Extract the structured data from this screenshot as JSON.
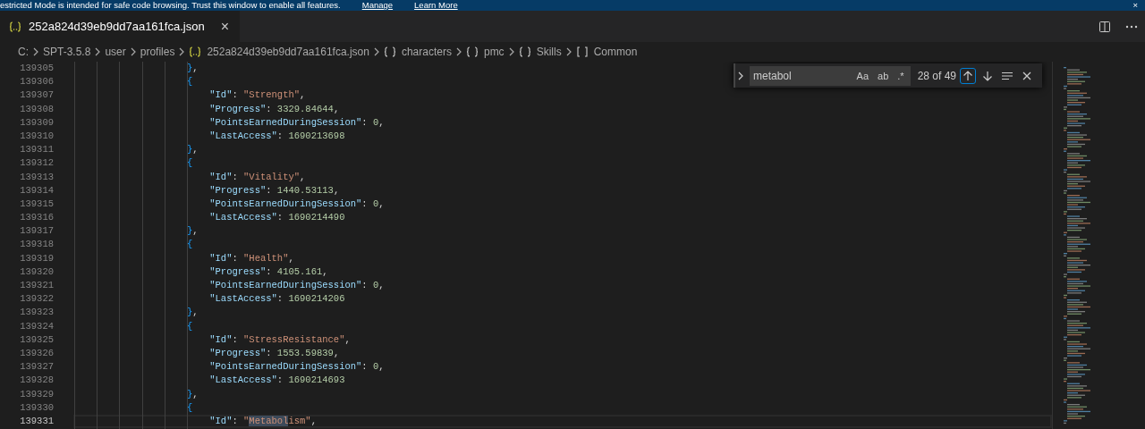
{
  "banner": {
    "text": "estricted Mode is intended for safe code browsing. Trust this window to enable all features.",
    "links": [
      "Manage",
      "Learn More"
    ],
    "close": "×"
  },
  "tabs": [
    {
      "label": "252a824d39eb9dd7aa161fca.json",
      "selected": true,
      "close": "×"
    }
  ],
  "breadcrumbs": [
    {
      "label": "C:",
      "kind": "folder"
    },
    {
      "label": "SPT-3.5.8",
      "kind": "folder"
    },
    {
      "label": "user",
      "kind": "folder"
    },
    {
      "label": "profiles",
      "kind": "folder"
    },
    {
      "label": "252a824d39eb9dd7aa161fca.json",
      "kind": "file"
    },
    {
      "label": "characters",
      "kind": "object"
    },
    {
      "label": "pmc",
      "kind": "object"
    },
    {
      "label": "Skills",
      "kind": "object"
    },
    {
      "label": "Common",
      "kind": "array"
    }
  ],
  "find": {
    "value": "metabol",
    "options": [
      {
        "label": "Aa",
        "on": false
      },
      {
        "label": "ab",
        "on": false
      },
      {
        "label": ".*",
        "on": false
      }
    ],
    "count": "28 of 49"
  },
  "lines": [
    {
      "number": "139305",
      "current": false,
      "tokens": [
        {
          "kind": "brace",
          "text": "                    }"
        },
        {
          "kind": "punct",
          "text": ","
        }
      ]
    },
    {
      "number": "139306",
      "current": false,
      "tokens": [
        {
          "kind": "brace",
          "text": "                    {"
        }
      ]
    },
    {
      "number": "139307",
      "current": false,
      "tokens": [
        {
          "kind": "key",
          "text": "                        \"Id\""
        },
        {
          "kind": "punct",
          "text": ": "
        },
        {
          "kind": "string",
          "text": "\"Strength\""
        },
        {
          "kind": "punct",
          "text": ","
        }
      ]
    },
    {
      "number": "139308",
      "current": false,
      "tokens": [
        {
          "kind": "key",
          "text": "                        \"Progress\""
        },
        {
          "kind": "punct",
          "text": ": "
        },
        {
          "kind": "number",
          "text": "3329.84644"
        },
        {
          "kind": "punct",
          "text": ","
        }
      ]
    },
    {
      "number": "139309",
      "current": false,
      "tokens": [
        {
          "kind": "key",
          "text": "                        \"PointsEarnedDuringSession\""
        },
        {
          "kind": "punct",
          "text": ": "
        },
        {
          "kind": "number",
          "text": "0"
        },
        {
          "kind": "punct",
          "text": ","
        }
      ]
    },
    {
      "number": "139310",
      "current": false,
      "tokens": [
        {
          "kind": "key",
          "text": "                        \"LastAccess\""
        },
        {
          "kind": "punct",
          "text": ": "
        },
        {
          "kind": "number",
          "text": "1690213698"
        }
      ]
    },
    {
      "number": "139311",
      "current": false,
      "tokens": [
        {
          "kind": "brace",
          "text": "                    }"
        },
        {
          "kind": "punct",
          "text": ","
        }
      ]
    },
    {
      "number": "139312",
      "current": false,
      "tokens": [
        {
          "kind": "brace",
          "text": "                    {"
        }
      ]
    },
    {
      "number": "139313",
      "current": false,
      "tokens": [
        {
          "kind": "key",
          "text": "                        \"Id\""
        },
        {
          "kind": "punct",
          "text": ": "
        },
        {
          "kind": "string",
          "text": "\"Vitality\""
        },
        {
          "kind": "punct",
          "text": ","
        }
      ]
    },
    {
      "number": "139314",
      "current": false,
      "tokens": [
        {
          "kind": "key",
          "text": "                        \"Progress\""
        },
        {
          "kind": "punct",
          "text": ": "
        },
        {
          "kind": "number",
          "text": "1440.53113"
        },
        {
          "kind": "punct",
          "text": ","
        }
      ]
    },
    {
      "number": "139315",
      "current": false,
      "tokens": [
        {
          "kind": "key",
          "text": "                        \"PointsEarnedDuringSession\""
        },
        {
          "kind": "punct",
          "text": ": "
        },
        {
          "kind": "number",
          "text": "0"
        },
        {
          "kind": "punct",
          "text": ","
        }
      ]
    },
    {
      "number": "139316",
      "current": false,
      "tokens": [
        {
          "kind": "key",
          "text": "                        \"LastAccess\""
        },
        {
          "kind": "punct",
          "text": ": "
        },
        {
          "kind": "number",
          "text": "1690214490"
        }
      ]
    },
    {
      "number": "139317",
      "current": false,
      "tokens": [
        {
          "kind": "brace",
          "text": "                    }"
        },
        {
          "kind": "punct",
          "text": ","
        }
      ]
    },
    {
      "number": "139318",
      "current": false,
      "tokens": [
        {
          "kind": "brace",
          "text": "                    {"
        }
      ]
    },
    {
      "number": "139319",
      "current": false,
      "tokens": [
        {
          "kind": "key",
          "text": "                        \"Id\""
        },
        {
          "kind": "punct",
          "text": ": "
        },
        {
          "kind": "string",
          "text": "\"Health\""
        },
        {
          "kind": "punct",
          "text": ","
        }
      ]
    },
    {
      "number": "139320",
      "current": false,
      "tokens": [
        {
          "kind": "key",
          "text": "                        \"Progress\""
        },
        {
          "kind": "punct",
          "text": ": "
        },
        {
          "kind": "number",
          "text": "4105.161"
        },
        {
          "kind": "punct",
          "text": ","
        }
      ]
    },
    {
      "number": "139321",
      "current": false,
      "tokens": [
        {
          "kind": "key",
          "text": "                        \"PointsEarnedDuringSession\""
        },
        {
          "kind": "punct",
          "text": ": "
        },
        {
          "kind": "number",
          "text": "0"
        },
        {
          "kind": "punct",
          "text": ","
        }
      ]
    },
    {
      "number": "139322",
      "current": false,
      "tokens": [
        {
          "kind": "key",
          "text": "                        \"LastAccess\""
        },
        {
          "kind": "punct",
          "text": ": "
        },
        {
          "kind": "number",
          "text": "1690214206"
        }
      ]
    },
    {
      "number": "139323",
      "current": false,
      "tokens": [
        {
          "kind": "brace",
          "text": "                    }"
        },
        {
          "kind": "punct",
          "text": ","
        }
      ]
    },
    {
      "number": "139324",
      "current": false,
      "tokens": [
        {
          "kind": "brace",
          "text": "                    {"
        }
      ]
    },
    {
      "number": "139325",
      "current": false,
      "tokens": [
        {
          "kind": "key",
          "text": "                        \"Id\""
        },
        {
          "kind": "punct",
          "text": ": "
        },
        {
          "kind": "string",
          "text": "\"StressResistance\""
        },
        {
          "kind": "punct",
          "text": ","
        }
      ]
    },
    {
      "number": "139326",
      "current": false,
      "tokens": [
        {
          "kind": "key",
          "text": "                        \"Progress\""
        },
        {
          "kind": "punct",
          "text": ": "
        },
        {
          "kind": "number",
          "text": "1553.59839"
        },
        {
          "kind": "punct",
          "text": ","
        }
      ]
    },
    {
      "number": "139327",
      "current": false,
      "tokens": [
        {
          "kind": "key",
          "text": "                        \"PointsEarnedDuringSession\""
        },
        {
          "kind": "punct",
          "text": ": "
        },
        {
          "kind": "number",
          "text": "0"
        },
        {
          "kind": "punct",
          "text": ","
        }
      ]
    },
    {
      "number": "139328",
      "current": false,
      "tokens": [
        {
          "kind": "key",
          "text": "                        \"LastAccess\""
        },
        {
          "kind": "punct",
          "text": ": "
        },
        {
          "kind": "number",
          "text": "1690214693"
        }
      ]
    },
    {
      "number": "139329",
      "current": false,
      "tokens": [
        {
          "kind": "brace",
          "text": "                    }"
        },
        {
          "kind": "punct",
          "text": ","
        }
      ]
    },
    {
      "number": "139330",
      "current": false,
      "tokens": [
        {
          "kind": "brace",
          "text": "                    {"
        }
      ]
    },
    {
      "number": "139331",
      "current": true,
      "tokens": [
        {
          "kind": "key",
          "text": "                        \"Id\""
        },
        {
          "kind": "punct",
          "text": ": "
        },
        {
          "kind": "string",
          "text": "\"",
          "match": false
        },
        {
          "kind": "string",
          "text": "Metabol",
          "match": true
        },
        {
          "kind": "string",
          "text": "ism\"",
          "match": false
        },
        {
          "kind": "punct",
          "text": ","
        }
      ]
    }
  ]
}
